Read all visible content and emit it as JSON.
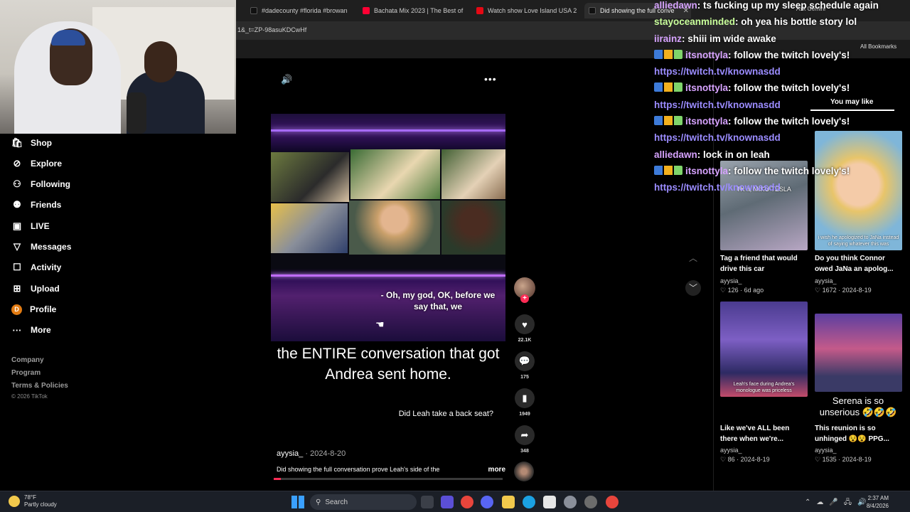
{
  "browser": {
    "tabs": [
      {
        "label": "#dadecounty #florida #browan",
        "color": "#111111"
      },
      {
        "label": "Bachata Mix 2023 | The Best of",
        "color": "#ff0033"
      },
      {
        "label": "Watch show Love Island USA 2",
        "color": "#e50914"
      },
      {
        "label": "Did showing the full conve",
        "color": "#111111"
      }
    ],
    "url": "1&_t=ZP-98asuKDCwHf",
    "ask_gemini": "Ask Gemini",
    "all_bookmarks": "All Bookmarks"
  },
  "nav": {
    "items": [
      {
        "label": "Shop",
        "icon": "shop-icon"
      },
      {
        "label": "Explore",
        "icon": "compass-icon"
      },
      {
        "label": "Following",
        "icon": "following-icon"
      },
      {
        "label": "Friends",
        "icon": "friends-icon"
      },
      {
        "label": "LIVE",
        "icon": "live-icon"
      },
      {
        "label": "Messages",
        "icon": "messages-icon"
      },
      {
        "label": "Activity",
        "icon": "activity-icon"
      },
      {
        "label": "Upload",
        "icon": "upload-icon"
      },
      {
        "label": "Profile",
        "icon": "profile-avatar",
        "initial": "D"
      },
      {
        "label": "More",
        "icon": "more-icon"
      }
    ],
    "footer": [
      "Company",
      "Program",
      "Terms & Policies"
    ],
    "copyright": "© 2026 TikTok"
  },
  "video": {
    "subtitle": "- Oh, my god, OK, before we say that, we",
    "caption": "the ENTIRE conversation that got Andrea sent home.",
    "question": "Did Leah take a back seat?",
    "author": "ayysia_",
    "date": "2024-8-20",
    "description": "Did showing the full conversation prove Leah's side of the",
    "more": "more",
    "progress": 0.03,
    "likes": "22.1K",
    "comments": "175",
    "saves": "1949",
    "shares": "348"
  },
  "recommendations": {
    "header": "You may like",
    "items": [
      {
        "title": "Tag a friend that would drive this car",
        "author": "ayysia_",
        "likes": "126",
        "date": "6d ago",
        "thumb_text": "TK it, MIKU TESLA"
      },
      {
        "title": "Do you think Connor owed JaNa an apolog...",
        "author": "ayysia_",
        "likes": "1672",
        "date": "2024-8-19",
        "thumb_text": "i wish he apologized to JaNa instead of saying whatever this was"
      },
      {
        "title": "Like we've ALL been there when we're...",
        "author": "ayysia_",
        "likes": "86",
        "date": "2024-8-19",
        "thumb_text": "Leah's face during Andrea's monologue was priceless"
      },
      {
        "title": "This reunion is so unhinged 😵😵 PPG...",
        "author": "ayysia_",
        "likes": "1535",
        "date": "2024-8-19",
        "thumb_text": "Serena is so unserious 🤣🤣🤣"
      }
    ]
  },
  "chat": [
    {
      "user": "alliedawn",
      "msg": ": ts fucking up my sleep schedule again",
      "badges": false
    },
    {
      "user": "stayoceanminded",
      "msg": ": oh yea his bottle story lol",
      "badges": false,
      "green": true
    },
    {
      "user": "iirainz",
      "msg": ": shiii im wide awake",
      "badges": false
    },
    {
      "user": "itsnottyla",
      "msg": ": follow the twitch lovely's!",
      "badges": true
    },
    {
      "link": "https://twitch.tv/knownasdd"
    },
    {
      "user": "itsnottyla",
      "msg": ": follow the twitch lovely's!",
      "badges": true
    },
    {
      "link": "https://twitch.tv/knownasdd"
    },
    {
      "user": "itsnottyla",
      "msg": ": follow the twitch lovely's!",
      "badges": true
    },
    {
      "link": "https://twitch.tv/knownasdd"
    },
    {
      "user": "alliedawn",
      "msg": ": lock in on leah",
      "badges": false
    },
    {
      "user": "itsnottyla",
      "msg": ": follow the twitch lovely's!",
      "badges": true
    },
    {
      "link": "https://twitch.tv/knownasdd"
    }
  ],
  "taskbar": {
    "temperature": "78°F",
    "weather": "Partly cloudy",
    "search": "Search",
    "time": "2:37 AM",
    "date": "8/4/2026"
  },
  "colors": {
    "accent": "#fe2c55",
    "chat_user": "#d7a3ff",
    "chat_link": "#9b8cff",
    "profile": "#e27b12"
  }
}
